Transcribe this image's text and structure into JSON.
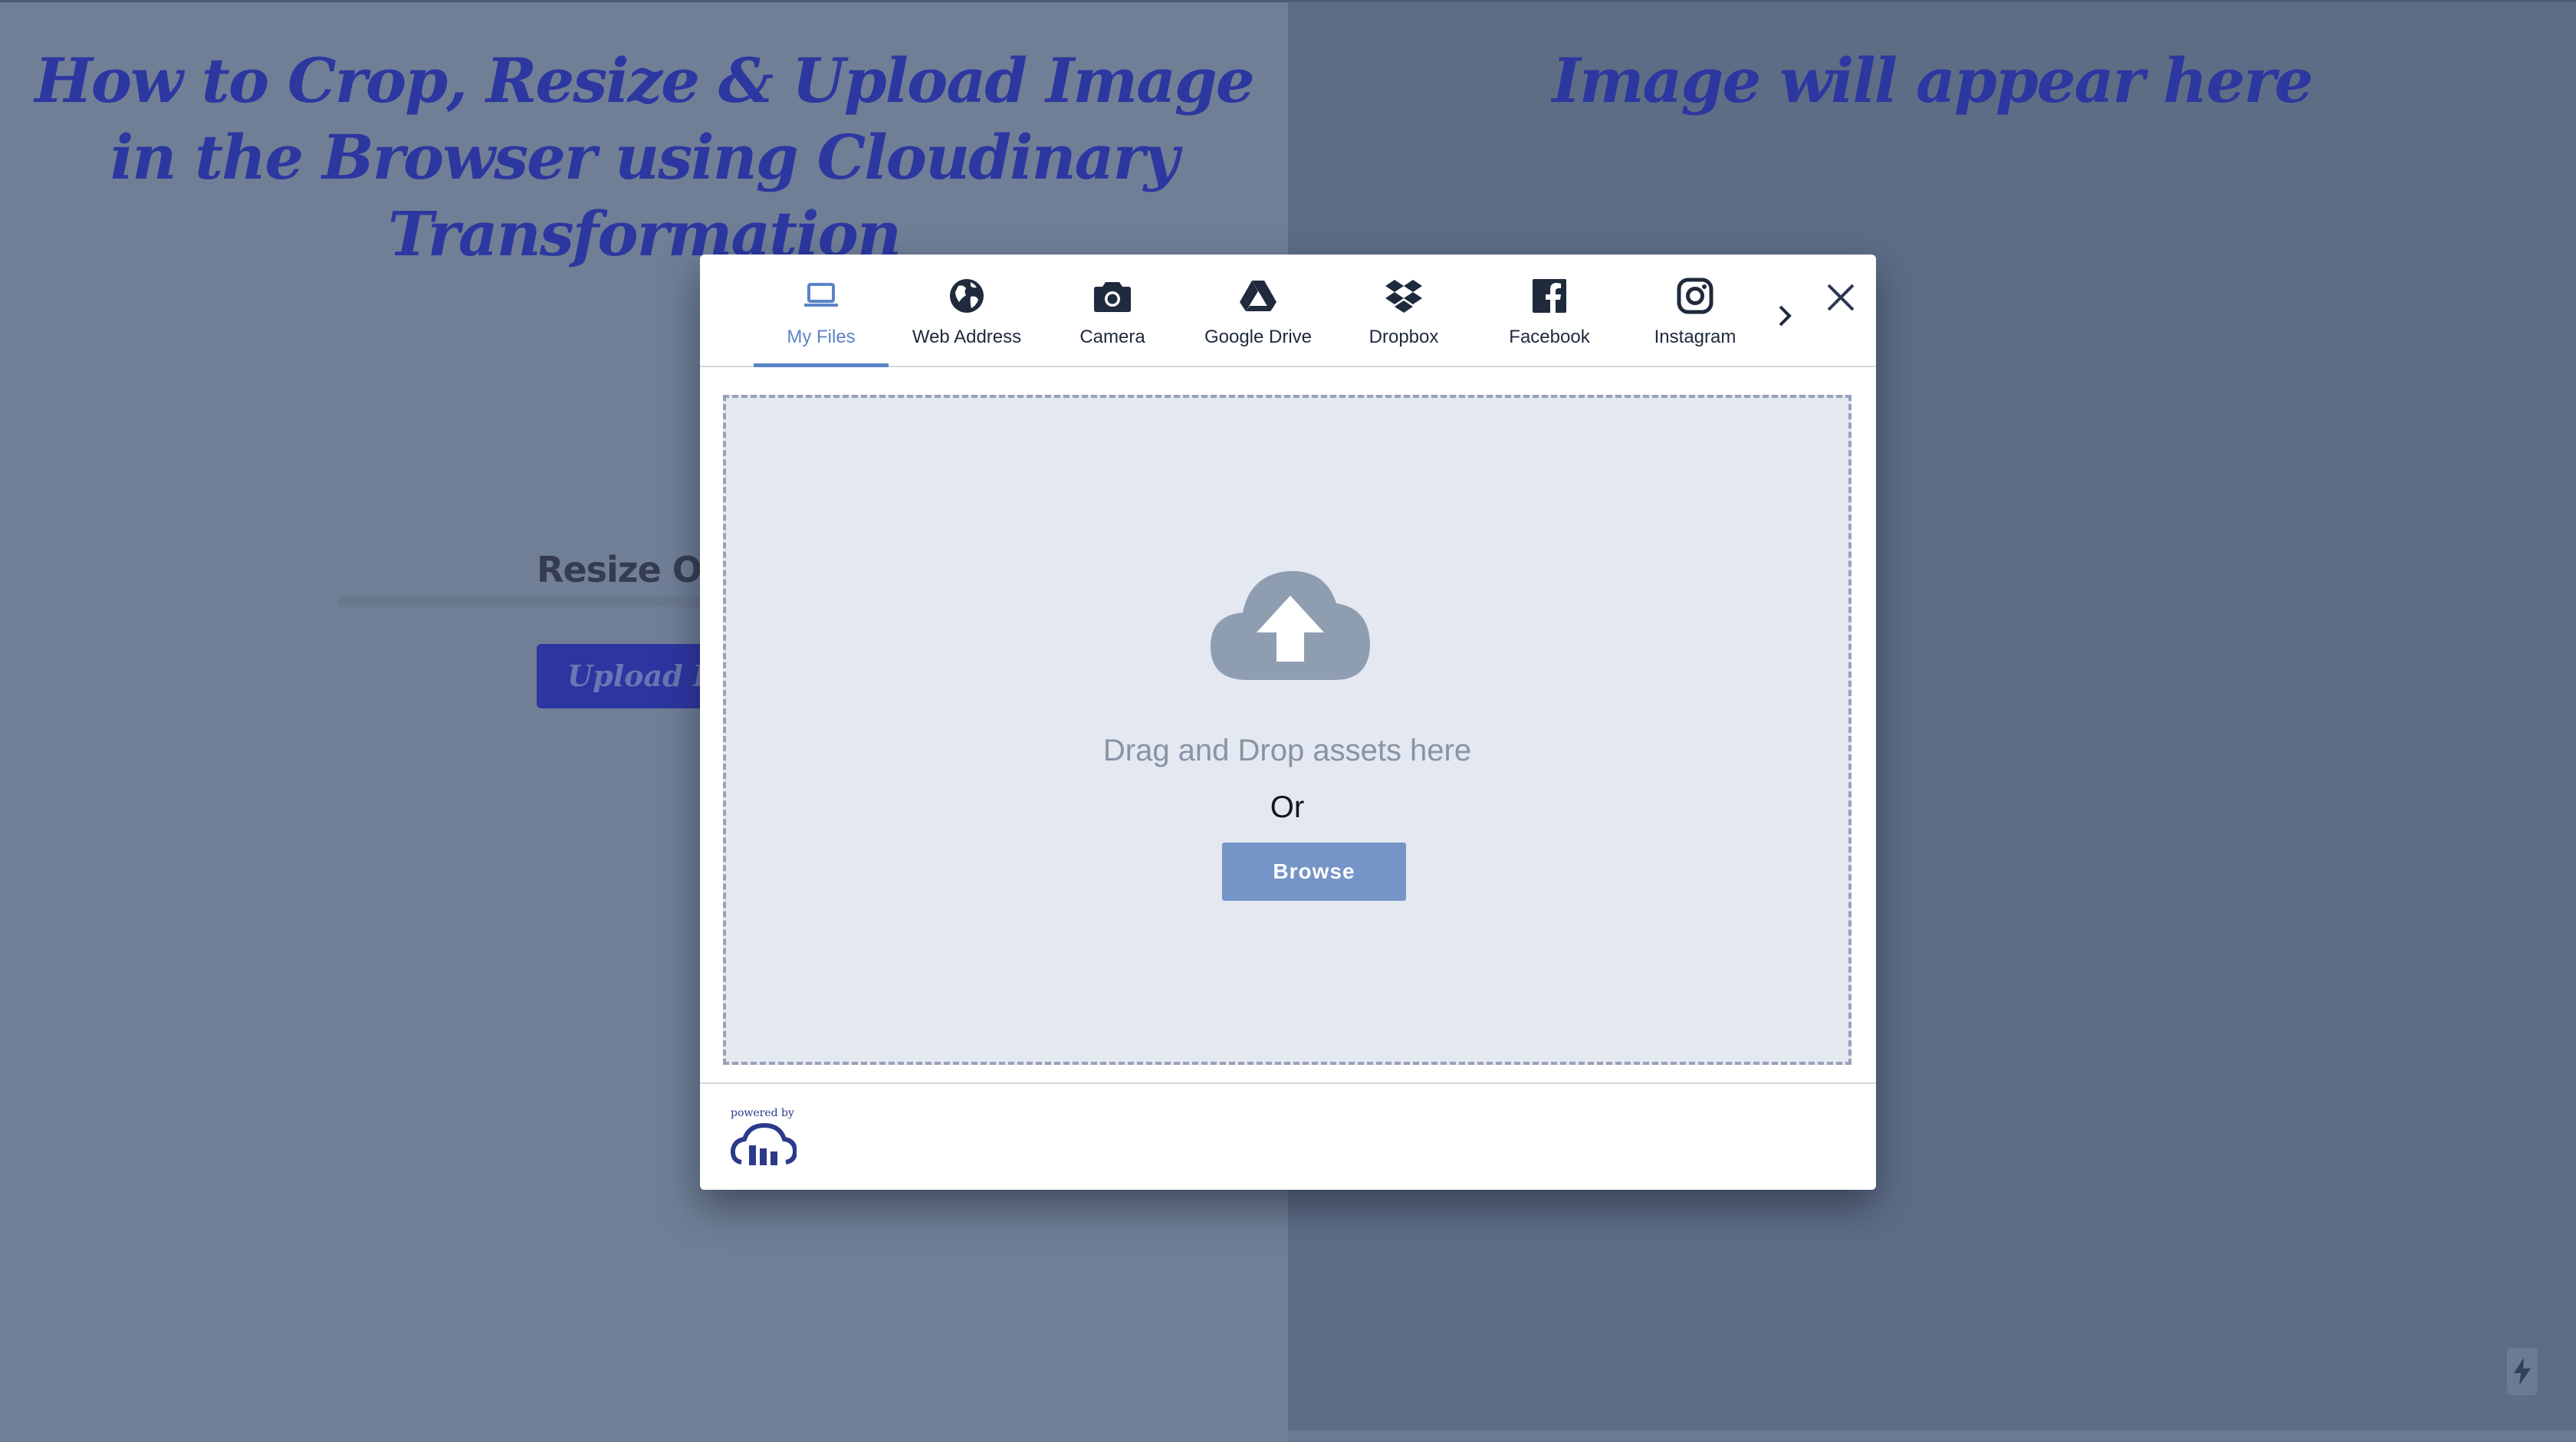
{
  "page": {
    "main_title": "How to Crop, Resize & Upload Image in the Browser using Cloudinary Transformation",
    "preview_title": "Image will appear here",
    "resize_label": "Resize Opti",
    "upload_button_label": "Upload Im"
  },
  "widget": {
    "tabs": [
      {
        "label": "My Files",
        "icon": "laptop-icon",
        "active": true
      },
      {
        "label": "Web Address",
        "icon": "globe-icon",
        "active": false
      },
      {
        "label": "Camera",
        "icon": "camera-icon",
        "active": false
      },
      {
        "label": "Google Drive",
        "icon": "google-drive-icon",
        "active": false
      },
      {
        "label": "Dropbox",
        "icon": "dropbox-icon",
        "active": false
      },
      {
        "label": "Facebook",
        "icon": "facebook-icon",
        "active": false
      },
      {
        "label": "Instagram",
        "icon": "instagram-icon",
        "active": false
      }
    ],
    "drop_text": "Drag and Drop assets here",
    "or_text": "Or",
    "browse_label": "Browse",
    "powered_by": "powered by"
  },
  "colors": {
    "accent": "#5b84c6",
    "title": "#2c37a0",
    "browse_button": "#7594c7",
    "drop_area_bg": "#e4e8f0"
  }
}
